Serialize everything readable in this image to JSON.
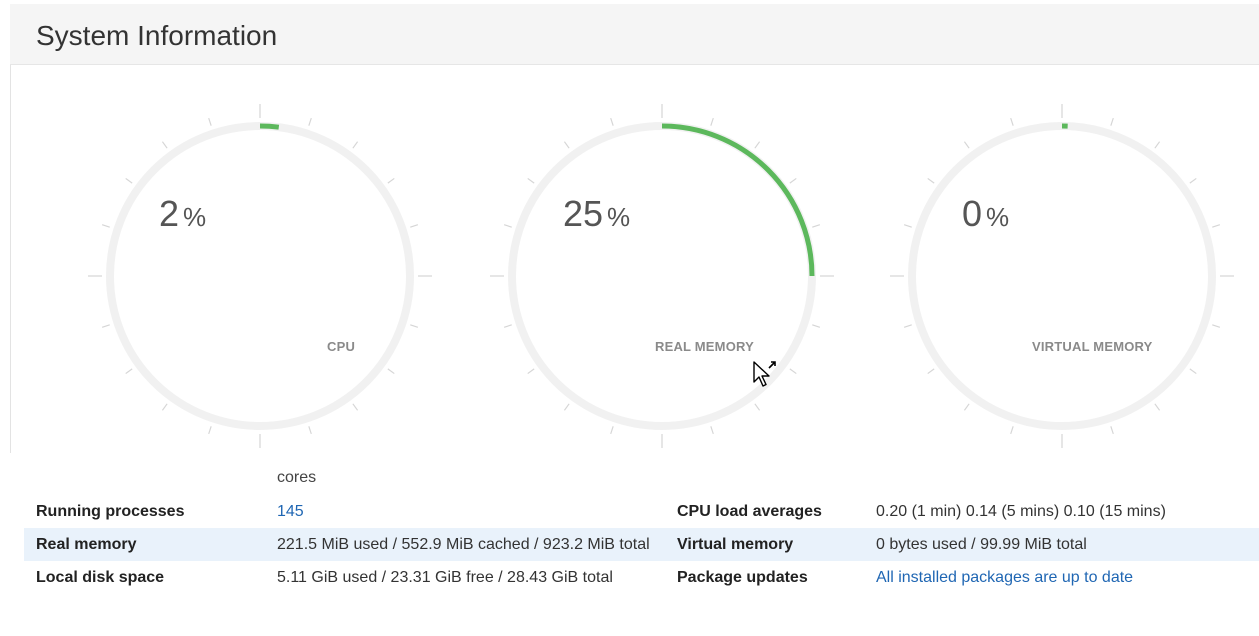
{
  "header": {
    "title": "System Information"
  },
  "gauges": [
    {
      "id": "cpu",
      "percent_value": 2,
      "percent": "2",
      "unit": "%",
      "label": "CPU",
      "color": "#5cb85c"
    },
    {
      "id": "real-memory",
      "percent_value": 25,
      "percent": "25",
      "unit": "%",
      "label": "REAL MEMORY",
      "color": "#5cb85c"
    },
    {
      "id": "virtual-memory",
      "percent_value": 0,
      "percent": "0",
      "unit": "%",
      "label": "VIRTUAL MEMORY",
      "color": "#5cb85c"
    }
  ],
  "info": {
    "cut_text": "cores",
    "rows": [
      {
        "label1": "Running processes",
        "value1": "145",
        "label2": "CPU load averages",
        "value2": "0.20 (1 min) 0.14 (5 mins) 0.10 (15 mins)"
      },
      {
        "label1": "Real memory",
        "value1": "221.5 MiB used / 552.9 MiB cached / 923.2 MiB total",
        "label2": "Virtual memory",
        "value2": "0 bytes used / 99.99 MiB total"
      },
      {
        "label1": "Local disk space",
        "value1": "5.11 GiB used / 23.31 GiB free / 28.43 GiB total",
        "label2": "Package updates",
        "value2": "All installed packages are up to date"
      }
    ]
  },
  "colors": {
    "accent": "#5cb85c",
    "link": "#1f66b3",
    "row_highlight": "#e9f2fb",
    "header_bg": "#f5f5f5"
  }
}
